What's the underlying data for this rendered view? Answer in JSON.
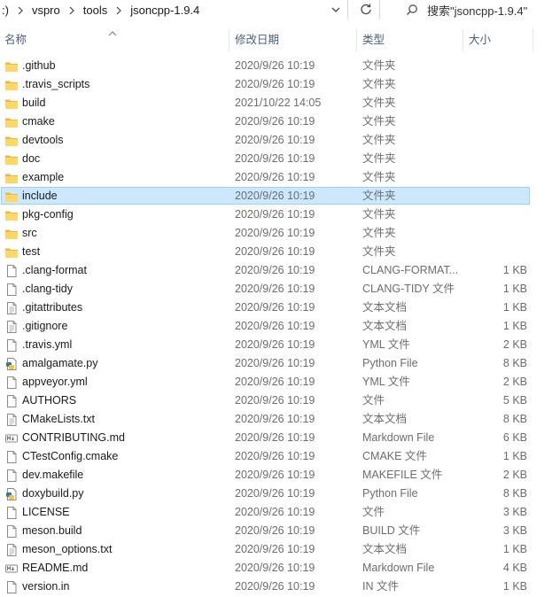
{
  "address": {
    "crumbs": [
      ":)",
      "vspro",
      "tools",
      "jsoncpp-1.9.4"
    ]
  },
  "search": {
    "placeholder": "搜索\"jsoncpp-1.9.4\""
  },
  "columns": {
    "name": "名称",
    "date": "修改日期",
    "type": "类型",
    "size": "大小"
  },
  "files": [
    {
      "name": ".github",
      "date": "2020/9/26 10:19",
      "type": "文件夹",
      "size": "",
      "icon": "folder-icon"
    },
    {
      "name": ".travis_scripts",
      "date": "2020/9/26 10:19",
      "type": "文件夹",
      "size": "",
      "icon": "folder-icon"
    },
    {
      "name": "build",
      "date": "2021/10/22 14:05",
      "type": "文件夹",
      "size": "",
      "icon": "folder-icon"
    },
    {
      "name": "cmake",
      "date": "2020/9/26 10:19",
      "type": "文件夹",
      "size": "",
      "icon": "folder-icon"
    },
    {
      "name": "devtools",
      "date": "2020/9/26 10:19",
      "type": "文件夹",
      "size": "",
      "icon": "folder-icon"
    },
    {
      "name": "doc",
      "date": "2020/9/26 10:19",
      "type": "文件夹",
      "size": "",
      "icon": "folder-icon"
    },
    {
      "name": "example",
      "date": "2020/9/26 10:19",
      "type": "文件夹",
      "size": "",
      "icon": "folder-icon"
    },
    {
      "name": "include",
      "date": "2020/9/26 10:19",
      "type": "文件夹",
      "size": "",
      "icon": "folder-icon",
      "selected": true
    },
    {
      "name": "pkg-config",
      "date": "2020/9/26 10:19",
      "type": "文件夹",
      "size": "",
      "icon": "folder-icon"
    },
    {
      "name": "src",
      "date": "2020/9/26 10:19",
      "type": "文件夹",
      "size": "",
      "icon": "folder-icon"
    },
    {
      "name": "test",
      "date": "2020/9/26 10:19",
      "type": "文件夹",
      "size": "",
      "icon": "folder-icon"
    },
    {
      "name": ".clang-format",
      "date": "2020/9/26 10:19",
      "type": "CLANG-FORMAT...",
      "size": "1 KB",
      "icon": "blank-file-icon"
    },
    {
      "name": ".clang-tidy",
      "date": "2020/9/26 10:19",
      "type": "CLANG-TIDY 文件",
      "size": "1 KB",
      "icon": "blank-file-icon"
    },
    {
      "name": ".gitattributes",
      "date": "2020/9/26 10:19",
      "type": "文本文档",
      "size": "1 KB",
      "icon": "text-file-icon"
    },
    {
      "name": ".gitignore",
      "date": "2020/9/26 10:19",
      "type": "文本文档",
      "size": "1 KB",
      "icon": "text-file-icon"
    },
    {
      "name": ".travis.yml",
      "date": "2020/9/26 10:19",
      "type": "YML 文件",
      "size": "2 KB",
      "icon": "blank-file-icon"
    },
    {
      "name": "amalgamate.py",
      "date": "2020/9/26 10:19",
      "type": "Python File",
      "size": "8 KB",
      "icon": "python-file-icon"
    },
    {
      "name": "appveyor.yml",
      "date": "2020/9/26 10:19",
      "type": "YML 文件",
      "size": "2 KB",
      "icon": "blank-file-icon"
    },
    {
      "name": "AUTHORS",
      "date": "2020/9/26 10:19",
      "type": "文件",
      "size": "5 KB",
      "icon": "blank-file-icon"
    },
    {
      "name": "CMakeLists.txt",
      "date": "2020/9/26 10:19",
      "type": "文本文档",
      "size": "8 KB",
      "icon": "text-file-icon"
    },
    {
      "name": "CONTRIBUTING.md",
      "date": "2020/9/26 10:19",
      "type": "Markdown File",
      "size": "6 KB",
      "icon": "markdown-file-icon"
    },
    {
      "name": "CTestConfig.cmake",
      "date": "2020/9/26 10:19",
      "type": "CMAKE 文件",
      "size": "1 KB",
      "icon": "blank-file-icon"
    },
    {
      "name": "dev.makefile",
      "date": "2020/9/26 10:19",
      "type": "MAKEFILE 文件",
      "size": "2 KB",
      "icon": "blank-file-icon"
    },
    {
      "name": "doxybuild.py",
      "date": "2020/9/26 10:19",
      "type": "Python File",
      "size": "8 KB",
      "icon": "python-file-icon"
    },
    {
      "name": "LICENSE",
      "date": "2020/9/26 10:19",
      "type": "文件",
      "size": "3 KB",
      "icon": "blank-file-icon"
    },
    {
      "name": "meson.build",
      "date": "2020/9/26 10:19",
      "type": "BUILD 文件",
      "size": "3 KB",
      "icon": "blank-file-icon"
    },
    {
      "name": "meson_options.txt",
      "date": "2020/9/26 10:19",
      "type": "文本文档",
      "size": "1 KB",
      "icon": "text-file-icon"
    },
    {
      "name": "README.md",
      "date": "2020/9/26 10:19",
      "type": "Markdown File",
      "size": "4 KB",
      "icon": "markdown-file-icon"
    },
    {
      "name": "version.in",
      "date": "2020/9/26 10:19",
      "type": "IN 文件",
      "size": "1 KB",
      "icon": "blank-file-icon"
    }
  ]
}
